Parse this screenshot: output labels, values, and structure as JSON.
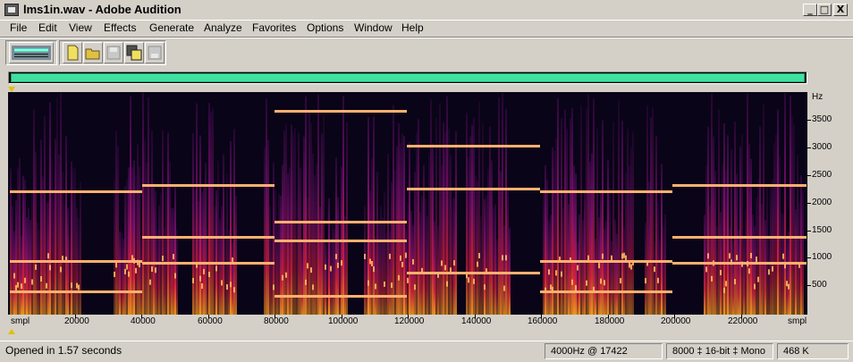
{
  "window": {
    "title": "lms1in.wav - Adobe Audition",
    "controls": [
      "_",
      "□",
      "X"
    ]
  },
  "menu": [
    "File",
    "Edit",
    "View",
    "Effects",
    "Generate",
    "Analyze",
    "Favorites",
    "Options",
    "Window",
    "Help"
  ],
  "toolbar": {
    "buttons": [
      "multitrack-view-icon",
      "new-file-icon",
      "open-folder-icon",
      "save-icon",
      "save-all-icon",
      "save-as-icon"
    ]
  },
  "spectral_view": {
    "freq_axis": {
      "unit": "Hz",
      "ticks": [
        "3500",
        "3000",
        "2500",
        "2000",
        "1500",
        "1000",
        "500"
      ]
    },
    "time_axis": {
      "unit_left": "smpl",
      "unit_right": "smpl",
      "ticks": [
        "20000",
        "40000",
        "60000",
        "80000",
        "100000",
        "120000",
        "140000",
        "160000",
        "180000",
        "200000",
        "220000"
      ]
    },
    "colors": {
      "background": "#0a0418",
      "harmonic_line": "#ffb070",
      "energy": "#ff5000",
      "overview": "#40e0a0"
    }
  },
  "status": {
    "message": "Opened in 1.57 seconds",
    "cursor": "4000Hz @ 17422",
    "format": "8000 ‡ 16-bit ‡ Mono",
    "size": "468 K"
  }
}
